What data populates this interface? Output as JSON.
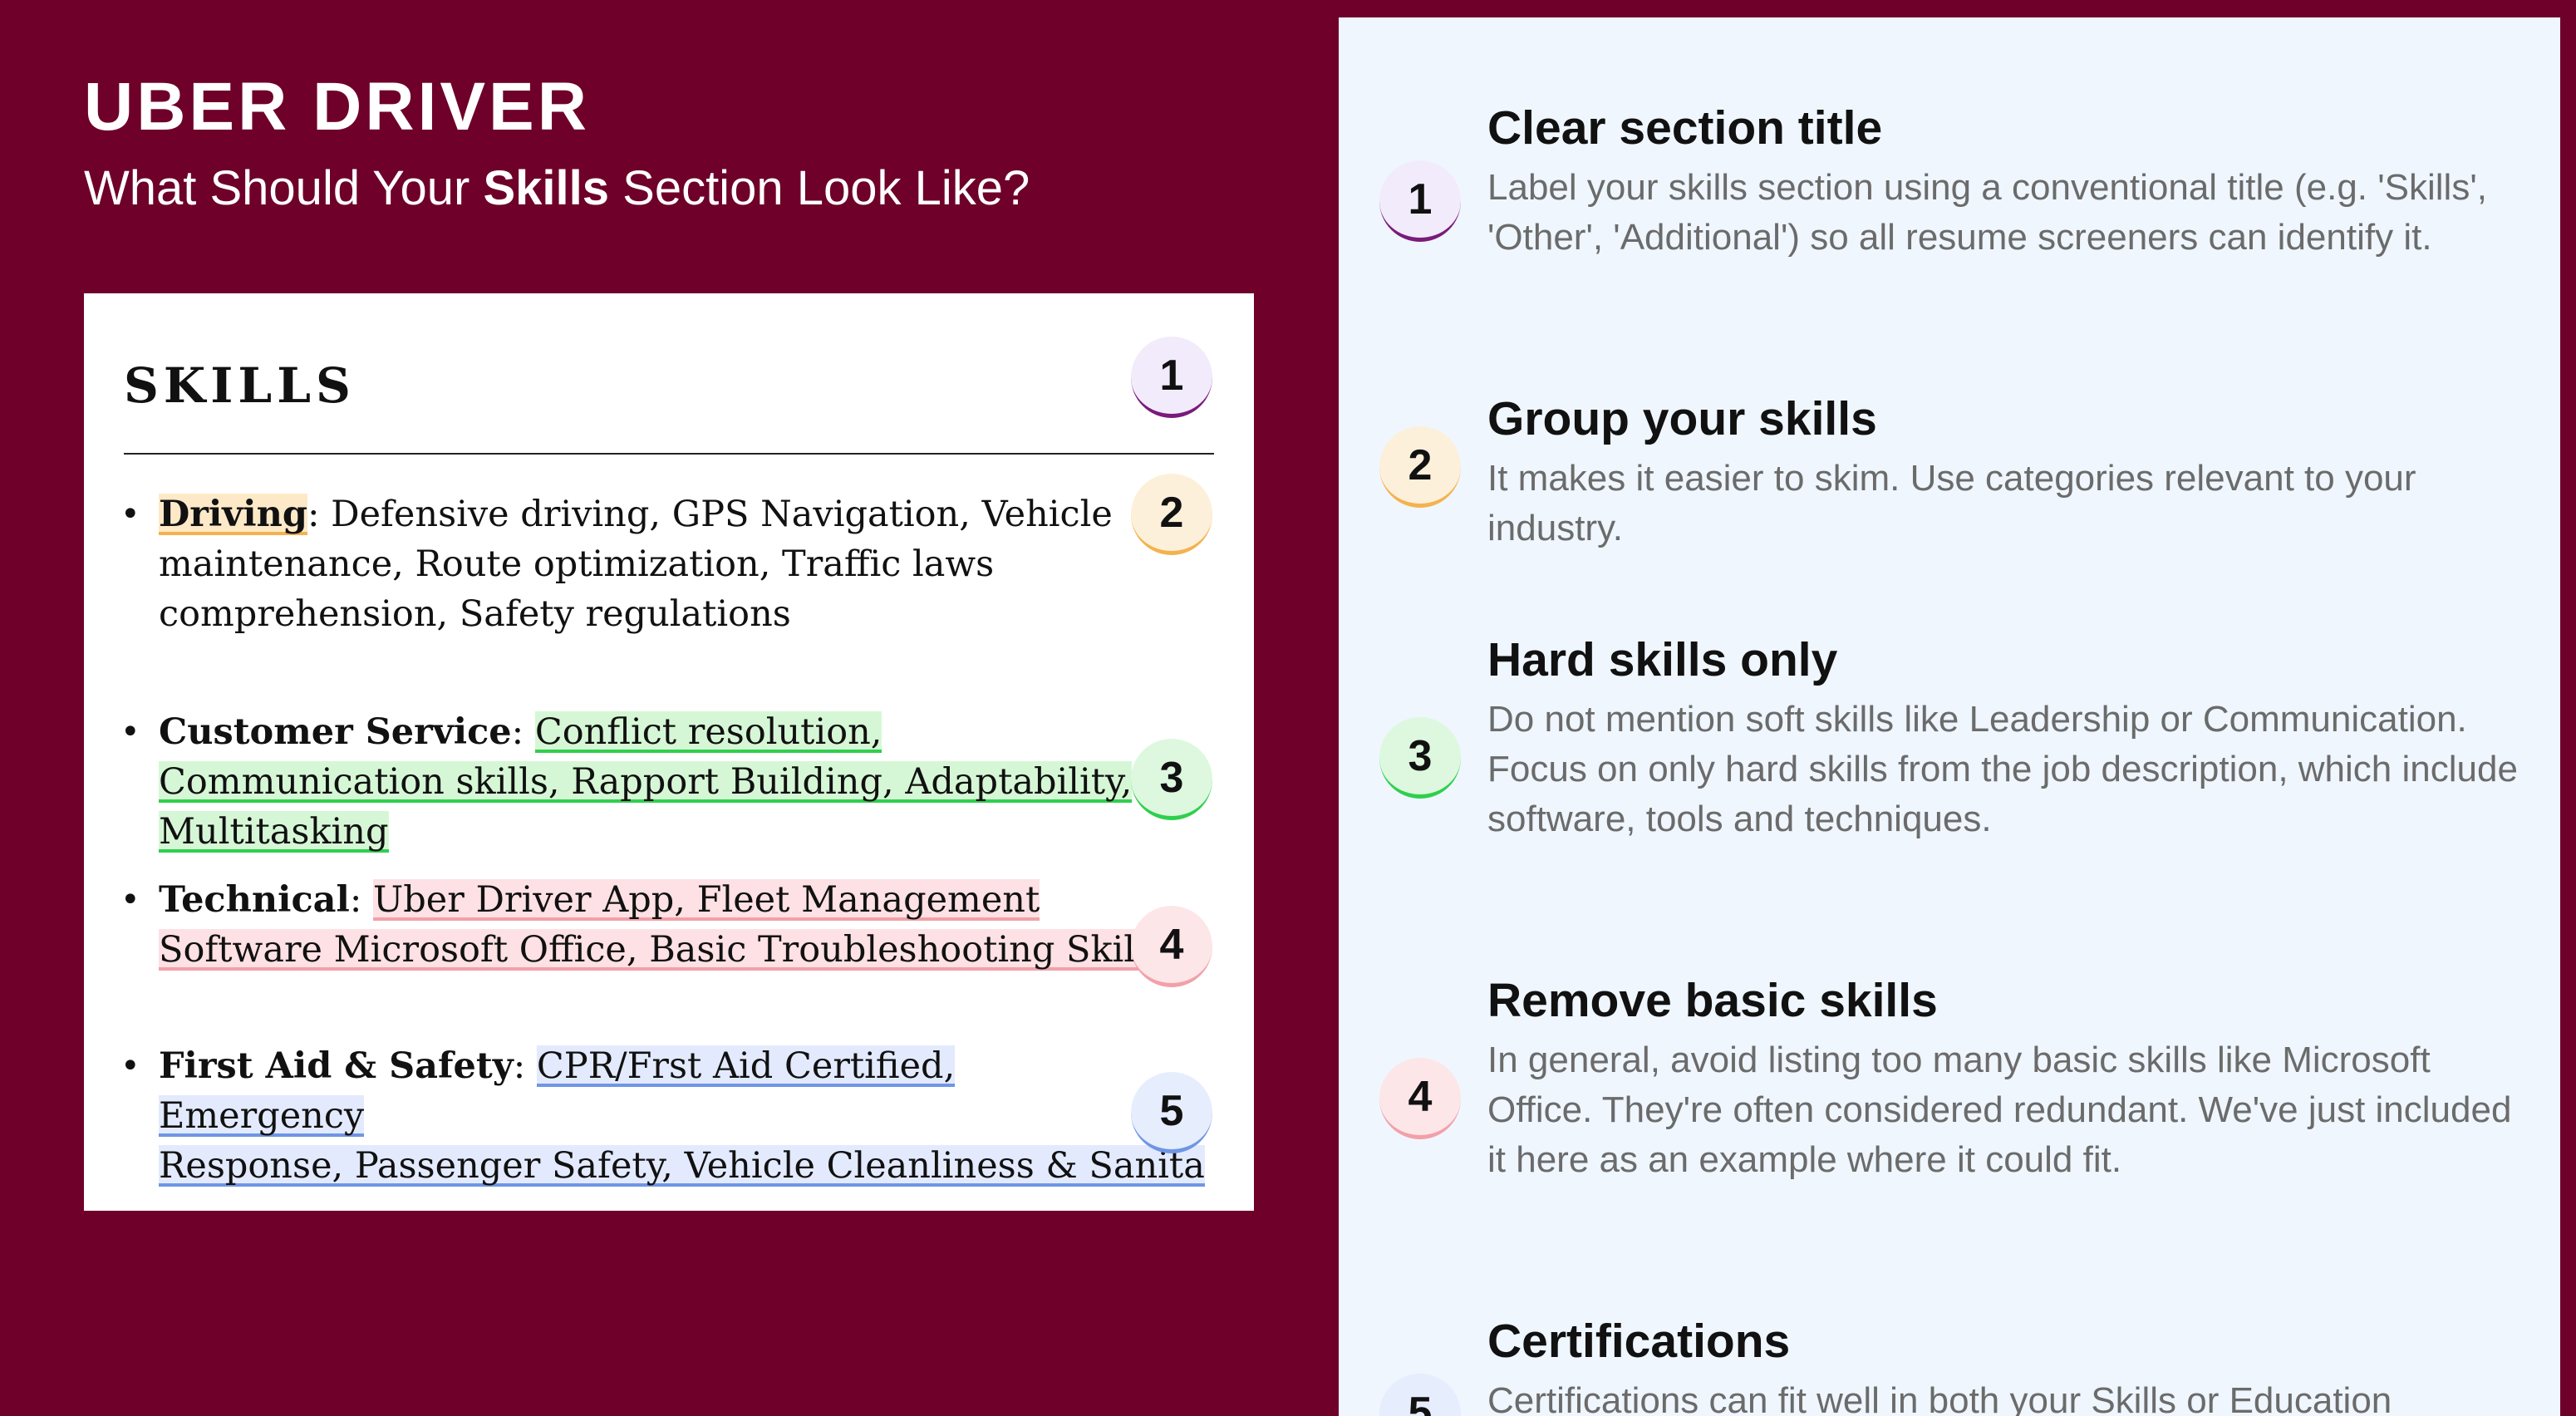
{
  "header": {
    "title": "UBER DRIVER",
    "subtitle_before": "What Should Your ",
    "subtitle_bold": "Skills",
    "subtitle_after": " Section Look Like?"
  },
  "resume": {
    "heading": "SKILLS",
    "items": [
      {
        "label": "Driving",
        "text": ": Defensive driving, GPS Navigation, Vehicle maintenance, Route optimization, Traffic laws comprehension, Safety regulations"
      },
      {
        "label": "Customer Service",
        "sep": ": ",
        "highlighted": "Conflict resolution, Communication skills, Rapport Building, Adaptability, Multitasking"
      },
      {
        "label": "Technical",
        "sep": ": ",
        "highlighted": "Uber Driver App, Fleet Management Software Microsoft Office, Basic Troubleshooting Skills"
      },
      {
        "label": "First Aid & Safety",
        "sep": ": ",
        "highlighted_line1": "CPR/Frst Aid Certified, Emergency",
        "highlighted_line2": "Response, Passenger Safety, Vehicle Cleanliness & Sanita"
      }
    ]
  },
  "badges": [
    "1",
    "2",
    "3",
    "4",
    "5"
  ],
  "tips": [
    {
      "title": "Clear section title",
      "text": "Label your skills section using a conventional title (e.g. 'Skills', 'Other', 'Additional') so all resume screeners can identify it."
    },
    {
      "title": "Group your skills",
      "text": "It makes it easier to skim. Use categories relevant to your industry."
    },
    {
      "title": "Hard skills only",
      "text": "Do not mention soft skills like Leadership or Communication. Focus on only hard skills from the job description, which include software, tools and techniques."
    },
    {
      "title": "Remove basic skills",
      "text": "In general, avoid listing too many basic skills like Microsoft Office. They're often considered redundant. We've just included it here as an example where it could fit."
    },
    {
      "title": "Certifications",
      "text": "Certifications can fit well in both your Skills or Education"
    }
  ],
  "colors": {
    "background": "#6e0029",
    "panel": "#eff6fe",
    "badge_1": "#7a1b7a",
    "badge_2": "#f4b24f",
    "badge_3": "#2fcf4d",
    "badge_4": "#f2a0a8",
    "badge_5": "#6f95e5"
  }
}
